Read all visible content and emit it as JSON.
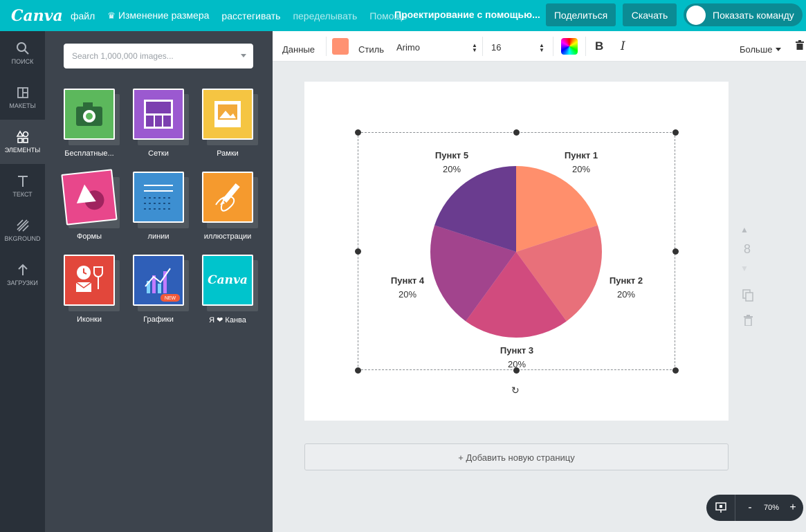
{
  "topbar": {
    "logo": "Canva",
    "menu": [
      {
        "label": "файл"
      },
      {
        "label": "Изменение размера"
      },
      {
        "label": "расстегивать"
      },
      {
        "label": "переделывать"
      },
      {
        "label": "Помощь"
      }
    ],
    "doc_title": "Проектирование с помощью...",
    "share_label": "Поделиться",
    "download_label": "Скачать",
    "team_label": "Показать команду"
  },
  "sidenav": [
    {
      "label": "поиск",
      "icon": "search-icon"
    },
    {
      "label": "макеты",
      "icon": "layouts-icon"
    },
    {
      "label": "элементы",
      "icon": "elements-icon",
      "active": true
    },
    {
      "label": "текст",
      "icon": "text-icon"
    },
    {
      "label": "BKGROUND",
      "icon": "background-icon"
    },
    {
      "label": "загрузки",
      "icon": "upload-icon"
    }
  ],
  "panel": {
    "search_placeholder": "Search 1,000,000 images...",
    "tiles": [
      {
        "label": "Бесплатные...",
        "color": "#5cb85c"
      },
      {
        "label": "Сетки",
        "color": "#9b59d0"
      },
      {
        "label": "Рамки",
        "color": "#f5c542"
      },
      {
        "label": "Формы",
        "color": "#e8478b"
      },
      {
        "label": "линии",
        "color": "#3d8fd1"
      },
      {
        "label": "иллюстрации",
        "color": "#f59a2e"
      },
      {
        "label": "Иконки",
        "color": "#e2473b"
      },
      {
        "label": "Графики",
        "color": "#2f5fb8",
        "badge": "NEW"
      },
      {
        "label": "Я ❤ Канва",
        "color": "#00c4cc",
        "logo": "Canva"
      }
    ]
  },
  "toolbar": {
    "data_label": "Данные",
    "swatch_color": "#ff9272",
    "style_label": "Стиль",
    "font": "Arimo",
    "font_size": "16",
    "bold": "B",
    "italic": "I",
    "more_label": "Больше"
  },
  "chart_data": {
    "type": "pie",
    "labels": [
      "Пункт 1",
      "Пункт 2",
      "Пункт 3",
      "Пункт 4",
      "Пункт 5"
    ],
    "values": [
      20,
      20,
      20,
      20,
      20
    ],
    "value_labels": [
      "20%",
      "20%",
      "20%",
      "20%",
      "20%"
    ],
    "colors": [
      "#ff8f6c",
      "#e8707a",
      "#d14b7e",
      "#a2448d",
      "#6a3c8f"
    ]
  },
  "canvas": {
    "add_page_label": "+ Добавить новую страницу",
    "page_number": "8"
  },
  "zoom": {
    "minus": "-",
    "level": "70%",
    "plus": "+"
  }
}
